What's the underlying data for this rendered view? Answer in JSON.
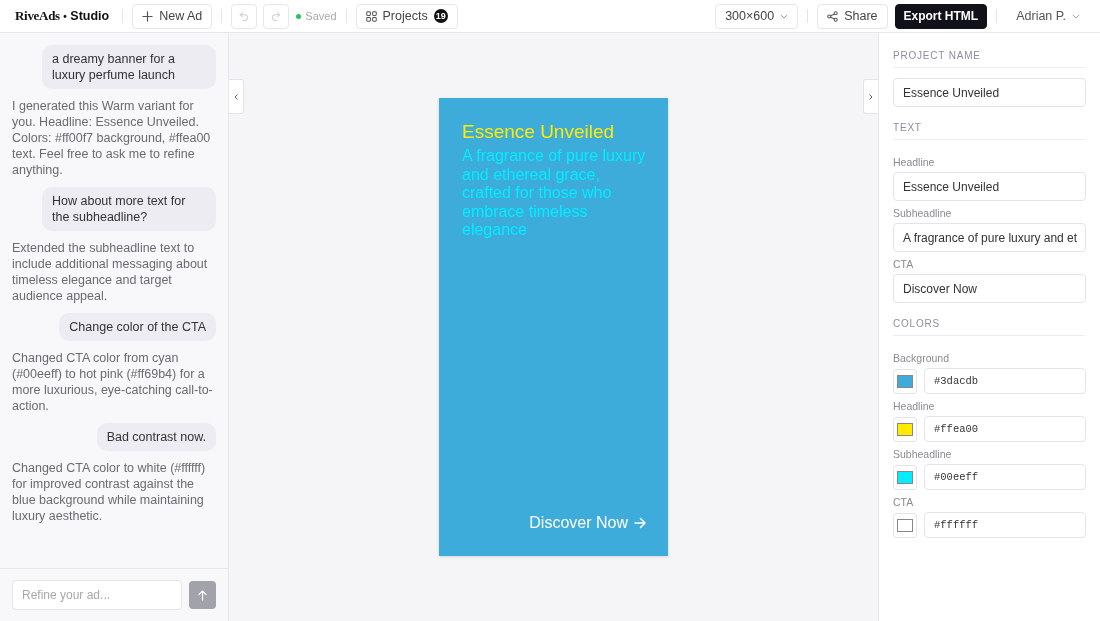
{
  "topbar": {
    "brand": {
      "name": "RiveAds",
      "separator": "•",
      "product": "Studio"
    },
    "new_ad": {
      "label": "New Ad"
    },
    "undo": {
      "disabled": true
    },
    "redo": {
      "disabled": true
    },
    "save_status": {
      "label": "Saved",
      "saved": true
    },
    "projects": {
      "label": "Projects",
      "count": "19"
    },
    "size": {
      "value": "300×600"
    },
    "share": {
      "label": "Share"
    },
    "export": {
      "label": "Export HTML"
    },
    "user": {
      "name": "Adrian P."
    }
  },
  "chat": {
    "messages": [
      {
        "kind": "user",
        "text": "a dreamy banner for a luxury perfume launch"
      },
      {
        "kind": "assistant",
        "text": "I generated this Warm variant for you. Headline: Essence Unveiled. Colors: #ff00f7 background, #ffea00 text. Feel free to ask me to refine anything."
      },
      {
        "kind": "user",
        "text": "How about more text for the subheadline?"
      },
      {
        "kind": "assistant",
        "text": "Extended the subheadline text to include additional messaging about timeless elegance and target audience appeal."
      },
      {
        "kind": "user",
        "text": "Change color of the CTA"
      },
      {
        "kind": "assistant",
        "text": "Changed CTA color from cyan (#00eeff) to hot pink (#ff69b4) for a more luxurious, eye-catching call-to-action."
      },
      {
        "kind": "user",
        "text": "Bad contrast now."
      },
      {
        "kind": "assistant",
        "text": "Changed CTA color to white (#ffffff) for improved contrast against the blue background while maintaining luxury aesthetic."
      }
    ],
    "composer": {
      "placeholder": "Refine your ad...",
      "send_disabled": true
    }
  },
  "preview": {
    "headline": "Essence Unveiled",
    "subheadline": "A fragrance of pure luxury and ethereal grace, crafted for those who embrace timeless elegance",
    "cta": "Discover Now"
  },
  "properties": {
    "project_name": {
      "heading": "PROJECT NAME",
      "value": "Essence Unveiled"
    },
    "text": {
      "heading": "TEXT",
      "fields": [
        {
          "label": "Headline",
          "value": "Essence Unveiled"
        },
        {
          "label": "Subheadline",
          "value": "A fragrance of pure luxury and et"
        },
        {
          "label": "CTA",
          "value": "Discover Now"
        }
      ]
    },
    "colors": {
      "heading": "COLORS",
      "fields": [
        {
          "label": "Background",
          "value": "#3dacdb",
          "color": "#3dacdb"
        },
        {
          "label": "Headline",
          "value": "#ffea00",
          "color": "#ffea00"
        },
        {
          "label": "Subheadline",
          "value": "#00eeff",
          "color": "#00eeff"
        },
        {
          "label": "CTA",
          "value": "#ffffff",
          "color": "#ffffff"
        }
      ]
    }
  }
}
